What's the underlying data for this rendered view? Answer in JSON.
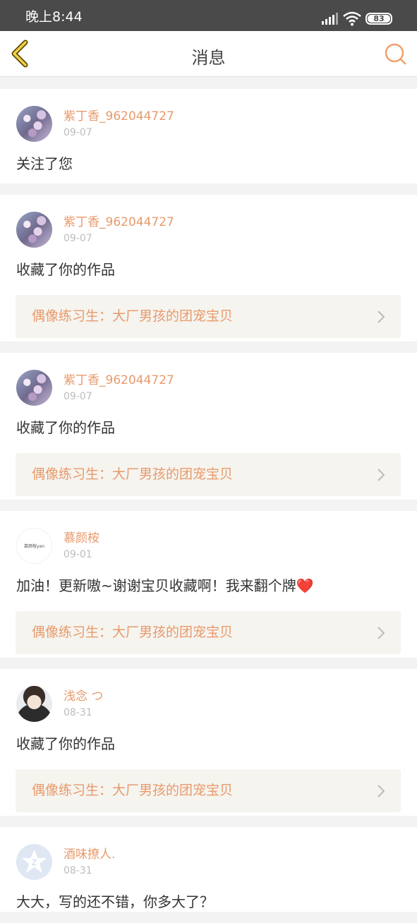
{
  "status": {
    "time": "晚上8:44",
    "battery": "83"
  },
  "header": {
    "title": "消息"
  },
  "messages": [
    {
      "name": "紫丁香_962044727",
      "date": "09-07",
      "action": "关注了您",
      "work": ""
    },
    {
      "name": "紫丁香_962044727",
      "date": "09-07",
      "action": "收藏了你的作品",
      "work": "偶像练习生：大厂男孩的团宠宝贝"
    },
    {
      "name": "紫丁香_962044727",
      "date": "09-07",
      "action": "收藏了你的作品",
      "work": "偶像练习生：大厂男孩的团宠宝贝"
    },
    {
      "name": "慕颜桉",
      "date": "09-01",
      "action": "加油！更新嗷~谢谢宝贝收藏啊！我来翻个牌❤️",
      "work": "偶像练习生：大厂男孩的团宠宝贝",
      "avatar_text": "慕颜桉yan"
    },
    {
      "name": "浅念 つ",
      "date": "08-31",
      "action": "收藏了你的作品",
      "work": "偶像练习生：大厂男孩的团宠宝贝"
    },
    {
      "name": "酒味撩人.",
      "date": "08-31",
      "action": "大大，写的还不错，你多大了？",
      "work": ""
    }
  ],
  "colors": {
    "accent": "#e89a6c",
    "status_bar": "#4a4a4a",
    "work_bg": "#f5f4ef"
  }
}
